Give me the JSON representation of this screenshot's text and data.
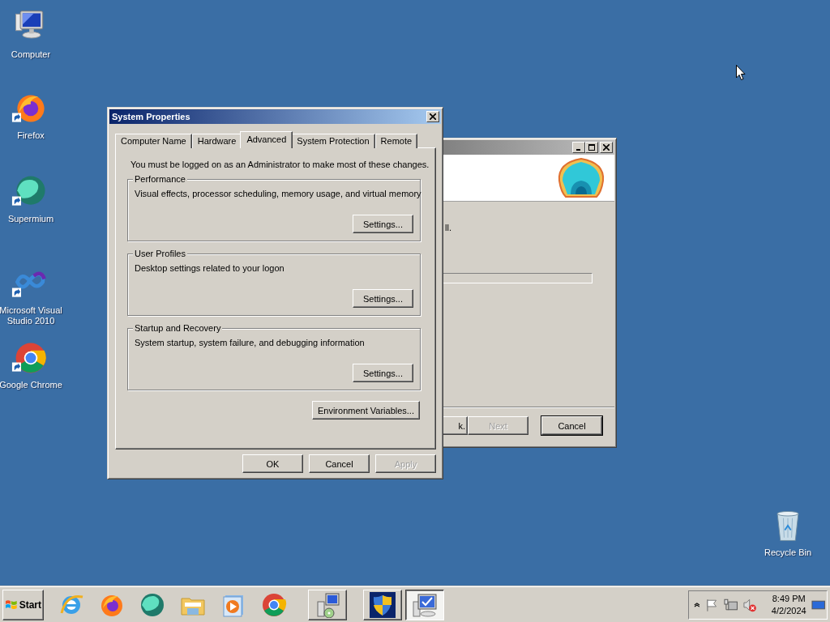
{
  "desktop_icons": [
    {
      "label": "Computer"
    },
    {
      "label": "Firefox"
    },
    {
      "label": "Supermium"
    },
    {
      "label": "Microsoft Visual Studio 2010"
    },
    {
      "label": "Google Chrome"
    },
    {
      "label": "Recycle Bin"
    }
  ],
  "background_window": {
    "text": "ll.",
    "buttons": [
      {
        "label": "k.",
        "disabled": false
      },
      {
        "label": "Next",
        "disabled": true
      },
      {
        "label": "Cancel",
        "disabled": false
      }
    ]
  },
  "window": {
    "title": "System Properties",
    "tabs": [
      {
        "label": "Computer Name",
        "selected": false
      },
      {
        "label": "Hardware",
        "selected": false
      },
      {
        "label": "Advanced",
        "selected": true
      },
      {
        "label": "System Protection",
        "selected": false
      },
      {
        "label": "Remote",
        "selected": false
      }
    ],
    "note": "You must be logged on as an Administrator to make most of these changes.",
    "groups": [
      {
        "title": "Performance",
        "description": "Visual effects, processor scheduling, memory usage, and virtual memory",
        "button": "Settings..."
      },
      {
        "title": "User Profiles",
        "description": "Desktop settings related to your logon",
        "button": "Settings..."
      },
      {
        "title": "Startup and Recovery",
        "description": "System startup, system failure, and debugging information",
        "button": "Settings..."
      }
    ],
    "extra_button": "Environment Variables...",
    "buttons": [
      {
        "label": "OK",
        "disabled": false
      },
      {
        "label": "Cancel",
        "disabled": false
      },
      {
        "label": "Apply",
        "disabled": true
      }
    ]
  },
  "taskbar": {
    "start": "Start",
    "windows": [
      {
        "selected": false
      },
      {
        "selected": false
      },
      {
        "selected": true
      }
    ],
    "time": "8:49 PM",
    "date": "4/2/2024"
  }
}
